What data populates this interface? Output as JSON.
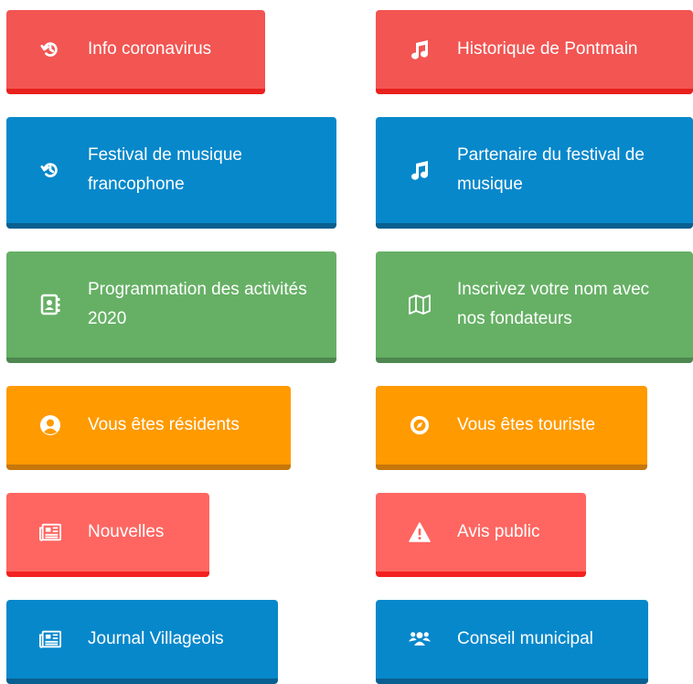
{
  "buttons": [
    {
      "label": "Info coronavirus",
      "icon": "history-icon",
      "color": "#f25552"
    },
    {
      "label": "Historique de Pontmain",
      "icon": "music-note-icon",
      "color": "#f25552"
    },
    {
      "label": "Festival de musique francophone",
      "icon": "history-icon",
      "color": "#0788cb"
    },
    {
      "label": "Partenaire du festival de musique",
      "icon": "music-note-icon",
      "color": "#0788cb"
    },
    {
      "label": "Programmation des activités 2020",
      "icon": "address-book-icon",
      "color": "#66b065"
    },
    {
      "label": "Inscrivez votre nom avec nos fondateurs",
      "icon": "map-icon",
      "color": "#66b065"
    },
    {
      "label": "Vous êtes résidents",
      "icon": "user-circle-icon",
      "color": "#ff9a00"
    },
    {
      "label": "Vous êtes touriste",
      "icon": "compass-icon",
      "color": "#ff9a00"
    },
    {
      "label": "Nouvelles",
      "icon": "newspaper-icon",
      "color": "#ff6661"
    },
    {
      "label": "Avis public",
      "icon": "warning-icon",
      "color": "#ff6661"
    },
    {
      "label": "Journal Villageois",
      "icon": "newspaper-icon",
      "color": "#0788cb"
    },
    {
      "label": "Conseil municipal",
      "icon": "users-icon",
      "color": "#0788cb"
    }
  ]
}
